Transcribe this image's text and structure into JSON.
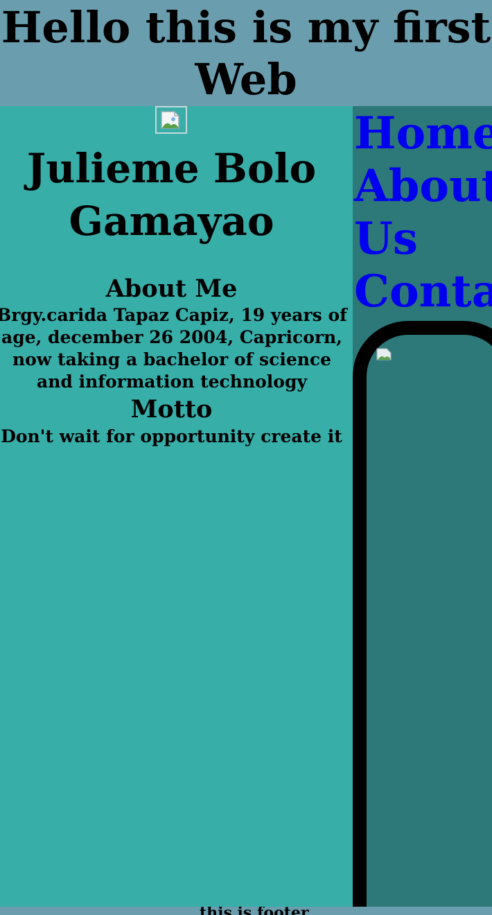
{
  "header": {
    "title": "Hello this is my first Web"
  },
  "profile": {
    "image_icon": "broken-image-icon",
    "name": "Julieme Bolo Gamayao",
    "about_title": "About Me",
    "about_text": "Brgy.carida Tapaz Capiz, 19 years of age, december 26 2004, Capricorn, now taking a bachelor of science and information technology",
    "motto_title": "Motto",
    "motto_text": "Don't wait for opportunity create it"
  },
  "nav": {
    "items": [
      {
        "label": "Home"
      },
      {
        "label": "About Us"
      },
      {
        "label": "Contact"
      }
    ]
  },
  "sidebar_image": {
    "icon": "broken-image-icon"
  },
  "footer": {
    "text": "this is footer"
  },
  "colors": {
    "header_bg": "#6a9eaf",
    "main_bg": "#38aea9",
    "sidebar_bg": "#2d7878",
    "link": "#0000ee"
  }
}
